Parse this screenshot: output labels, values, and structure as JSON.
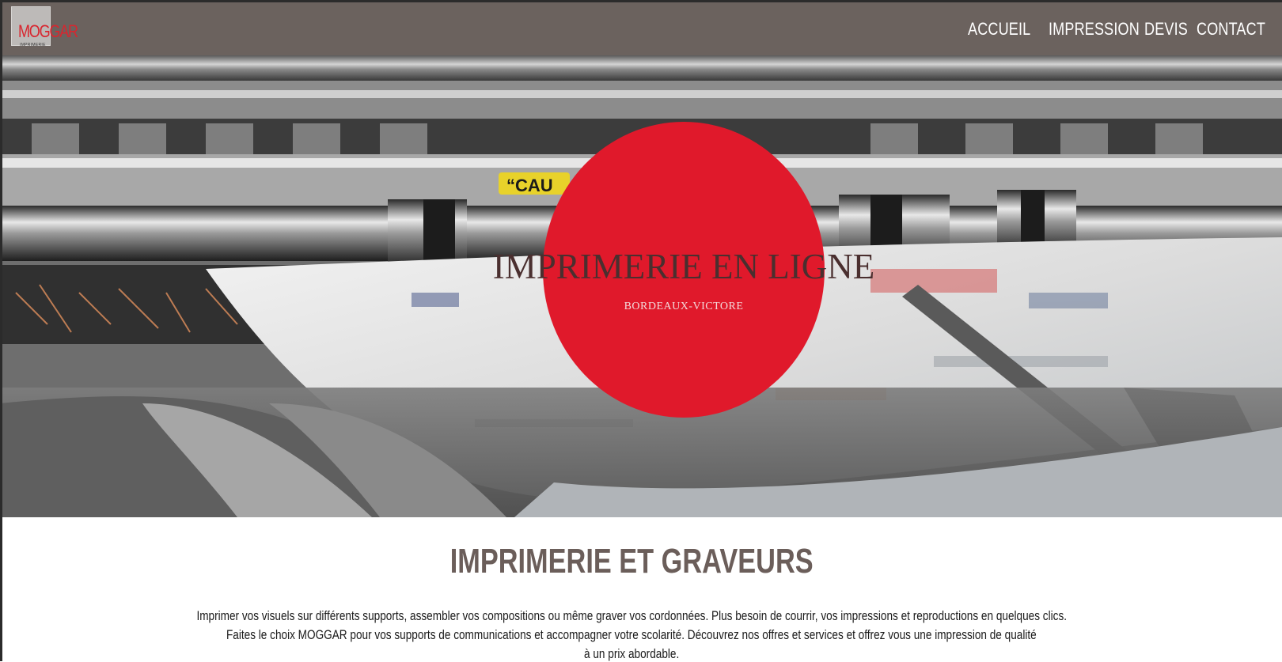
{
  "header": {
    "logo_text": "MOGGAR",
    "logo_subtext": "IMPRIMERIE",
    "nav": [
      "ACCUEIL",
      "IMPRESSION",
      "DEVIS",
      "CONTACT"
    ]
  },
  "hero": {
    "title": "IMPRIMERIE EN LIGNE",
    "subtitle": "BORDEAUX-VICTORE",
    "machine_label": "“CAU"
  },
  "section": {
    "title": "IMPRIMERIE ET GRAVEURS",
    "paragraph_lines": [
      "Imprimer vos visuels sur différents supports, assembler vos compositions ou même graver vos cordonnées. Plus besoin de courrir, vos impressions et reproductions en quelques clics.",
      "Faites le choix MOGGAR pour vos supports de communications et accompagner votre scolarité. Découvrez nos offres et services et offrez vous une impression de qualité",
      "à un prix abordable."
    ]
  },
  "colors": {
    "header_bg": "#6b625e",
    "accent_red": "#e0192b",
    "title_brown": "#6b5e5a"
  }
}
